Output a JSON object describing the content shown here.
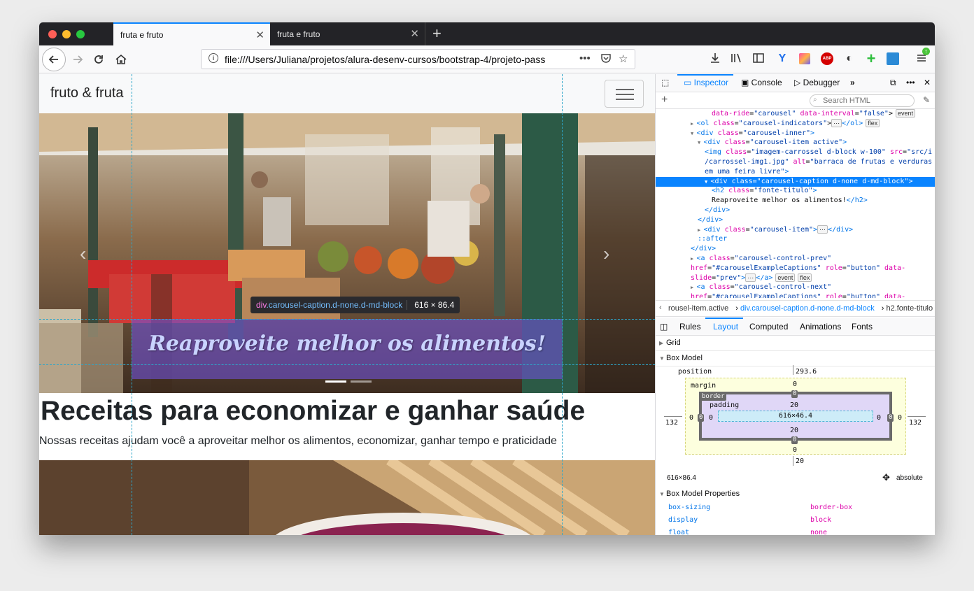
{
  "browser": {
    "tabs": [
      {
        "title": "fruta e fruto",
        "active": true
      },
      {
        "title": "fruta e fruto",
        "active": false
      }
    ],
    "url": "file:///Users/Juliana/projetos/alura-desenv-cursos/bootstrap-4/projeto-pass",
    "colors": {
      "accent": "#0a84ff",
      "tabstrip": "#232327"
    }
  },
  "page": {
    "brand": "fruto & fruta",
    "caption": "Reaproveite melhor os alimentos!",
    "heading": "Receitas para economizar e ganhar saúde",
    "lead": "Nossas receitas ajudam você a aproveitar melhor os alimentos, economizar, ganhar tempo e praticidade",
    "tooltip": {
      "tag": "div",
      "selector": ".carousel-caption.d-none.d-md-block",
      "size": "616 × 86.4"
    }
  },
  "devtools": {
    "tabs": [
      "Inspector",
      "Console",
      "Debugger"
    ],
    "search_placeholder": "Search HTML",
    "markup": [
      {
        "indent": 4,
        "parts": [
          [
            "att",
            "data-ride"
          ],
          [
            "p",
            "="
          ],
          [
            "val",
            "\"carousel\""
          ],
          [
            "p",
            " "
          ],
          [
            "att",
            "data-interval"
          ],
          [
            "p",
            "="
          ],
          [
            "val",
            "\"false\""
          ],
          [
            "p",
            ">"
          ]
        ],
        "badge": "event"
      },
      {
        "indent": 1,
        "tri": "▶",
        "parts": [
          [
            "tag",
            "<ol"
          ],
          [
            "p",
            " "
          ],
          [
            "att",
            "class"
          ],
          [
            "p",
            "="
          ],
          [
            "val",
            "\"carousel-indicators\""
          ],
          [
            "p",
            ">"
          ]
        ],
        "dots": true,
        "tail": "</ol>",
        "badge": "flex"
      },
      {
        "indent": 1,
        "tri": "▼",
        "parts": [
          [
            "tag",
            "<div"
          ],
          [
            "p",
            " "
          ],
          [
            "att",
            "class"
          ],
          [
            "p",
            "="
          ],
          [
            "val",
            "\"carousel-inner\""
          ],
          [
            "tag",
            ">"
          ]
        ]
      },
      {
        "indent": 2,
        "tri": "▼",
        "parts": [
          [
            "tag",
            "<div"
          ],
          [
            "p",
            " "
          ],
          [
            "att",
            "class"
          ],
          [
            "p",
            "="
          ],
          [
            "val",
            "\"carousel-item active\""
          ],
          [
            "tag",
            ">"
          ]
        ]
      },
      {
        "indent": 3,
        "parts": [
          [
            "tag",
            "<img"
          ],
          [
            "p",
            " "
          ],
          [
            "att",
            "class"
          ],
          [
            "p",
            "="
          ],
          [
            "val",
            "\"imagem-carrossel d-block w-100\""
          ],
          [
            "p",
            " "
          ],
          [
            "att",
            "src"
          ],
          [
            "p",
            "="
          ],
          [
            "val",
            "\"src/i"
          ]
        ]
      },
      {
        "indent": 3,
        "parts": [
          [
            "val",
            "/carrossel-img1.jpg\""
          ],
          [
            "p",
            " "
          ],
          [
            "att",
            "alt"
          ],
          [
            "p",
            "="
          ],
          [
            "val",
            "\"barraca de frutas e verduras"
          ]
        ]
      },
      {
        "indent": 3,
        "parts": [
          [
            "val",
            "em uma feira livre\""
          ],
          [
            "tag",
            ">"
          ]
        ]
      },
      {
        "indent": 3,
        "tri": "▼",
        "selected": true,
        "parts": [
          [
            "tag",
            "<div"
          ],
          [
            "p",
            " "
          ],
          [
            "att",
            "class=\"carousel-caption d-none d-md-block\""
          ],
          [
            "tag",
            ">"
          ]
        ]
      },
      {
        "indent": 4,
        "parts": [
          [
            "tag",
            "<h2"
          ],
          [
            "p",
            " "
          ],
          [
            "att",
            "class"
          ],
          [
            "p",
            "="
          ],
          [
            "val",
            "\"fonte-titulo\""
          ],
          [
            "tag",
            ">"
          ]
        ]
      },
      {
        "indent": 4,
        "parts": [
          [
            "p",
            "Reaproveite melhor os alimentos!"
          ],
          [
            "tag",
            "</h2>"
          ]
        ]
      },
      {
        "indent": 3,
        "parts": [
          [
            "tag",
            "</div>"
          ]
        ]
      },
      {
        "indent": 2,
        "parts": [
          [
            "tag",
            "</div>"
          ]
        ]
      },
      {
        "indent": 2,
        "tri": "▶",
        "parts": [
          [
            "tag",
            "<div"
          ],
          [
            "p",
            " "
          ],
          [
            "att",
            "class"
          ],
          [
            "p",
            "="
          ],
          [
            "val",
            "\"carousel-item\""
          ],
          [
            "tag",
            ">"
          ]
        ],
        "dots": true,
        "tail": "</div>"
      },
      {
        "indent": 2,
        "parts": [
          [
            "tag",
            "::after"
          ]
        ]
      },
      {
        "indent": 1,
        "parts": [
          [
            "tag",
            "</div>"
          ]
        ]
      },
      {
        "indent": 1,
        "tri": "▶",
        "parts": [
          [
            "tag",
            "<a"
          ],
          [
            "p",
            " "
          ],
          [
            "att",
            "class"
          ],
          [
            "p",
            "="
          ],
          [
            "val",
            "\"carousel-control-prev\""
          ]
        ]
      },
      {
        "indent": 1,
        "parts": [
          [
            "att",
            "href"
          ],
          [
            "p",
            "="
          ],
          [
            "val",
            "\"#carouselExampleCaptions\""
          ],
          [
            "p",
            " "
          ],
          [
            "att",
            "role"
          ],
          [
            "p",
            "="
          ],
          [
            "val",
            "\"button\""
          ],
          [
            "p",
            " "
          ],
          [
            "att",
            "data-"
          ]
        ]
      },
      {
        "indent": 1,
        "parts": [
          [
            "att",
            "slide"
          ],
          [
            "p",
            "="
          ],
          [
            "val",
            "\"prev\""
          ],
          [
            "tag",
            ">"
          ]
        ],
        "dots": true,
        "tail": "</a>",
        "badge": "event",
        "badge2": "flex"
      },
      {
        "indent": 1,
        "tri": "▶",
        "parts": [
          [
            "tag",
            "<a"
          ],
          [
            "p",
            " "
          ],
          [
            "att",
            "class"
          ],
          [
            "p",
            "="
          ],
          [
            "val",
            "\"carousel-control-next\""
          ]
        ]
      },
      {
        "indent": 1,
        "parts": [
          [
            "att",
            "href"
          ],
          [
            "p",
            "="
          ],
          [
            "val",
            "\"#carouselExampleCaptions\""
          ],
          [
            "p",
            " "
          ],
          [
            "att",
            "role"
          ],
          [
            "p",
            "="
          ],
          [
            "val",
            "\"button\""
          ],
          [
            "p",
            " "
          ],
          [
            "att",
            "data-"
          ]
        ]
      }
    ],
    "breadcrumbs": [
      "rousel-item.active",
      "div.carousel-caption.d-none.d-md-block",
      "h2.fonte-titulo"
    ],
    "side_tabs": [
      "Rules",
      "Layout",
      "Computed",
      "Animations",
      "Fonts"
    ],
    "sections": {
      "grid": "Grid",
      "box_model": "Box Model",
      "box_model_props": "Box Model Properties"
    },
    "box_model": {
      "position_label": "position",
      "position_top": "293.6",
      "position_bottom": "20",
      "position_left": "132",
      "position_right": "132",
      "margin_label": "margin",
      "margin_top": "0",
      "margin_bottom": "0",
      "margin_left": "0",
      "margin_right": "0",
      "border_label": "border",
      "border_top": "0",
      "border_bottom": "0",
      "border_left": "0",
      "border_right": "0",
      "padding_label": "padding",
      "padding_top": "20",
      "padding_bottom": "20",
      "padding_left": "0",
      "padding_right": "0",
      "content": "616×46.4"
    },
    "element_size": "616×86.4",
    "position_mode": "absolute",
    "properties": [
      {
        "name": "box-sizing",
        "value": "border-box"
      },
      {
        "name": "display",
        "value": "block"
      },
      {
        "name": "float",
        "value": "none"
      }
    ]
  }
}
